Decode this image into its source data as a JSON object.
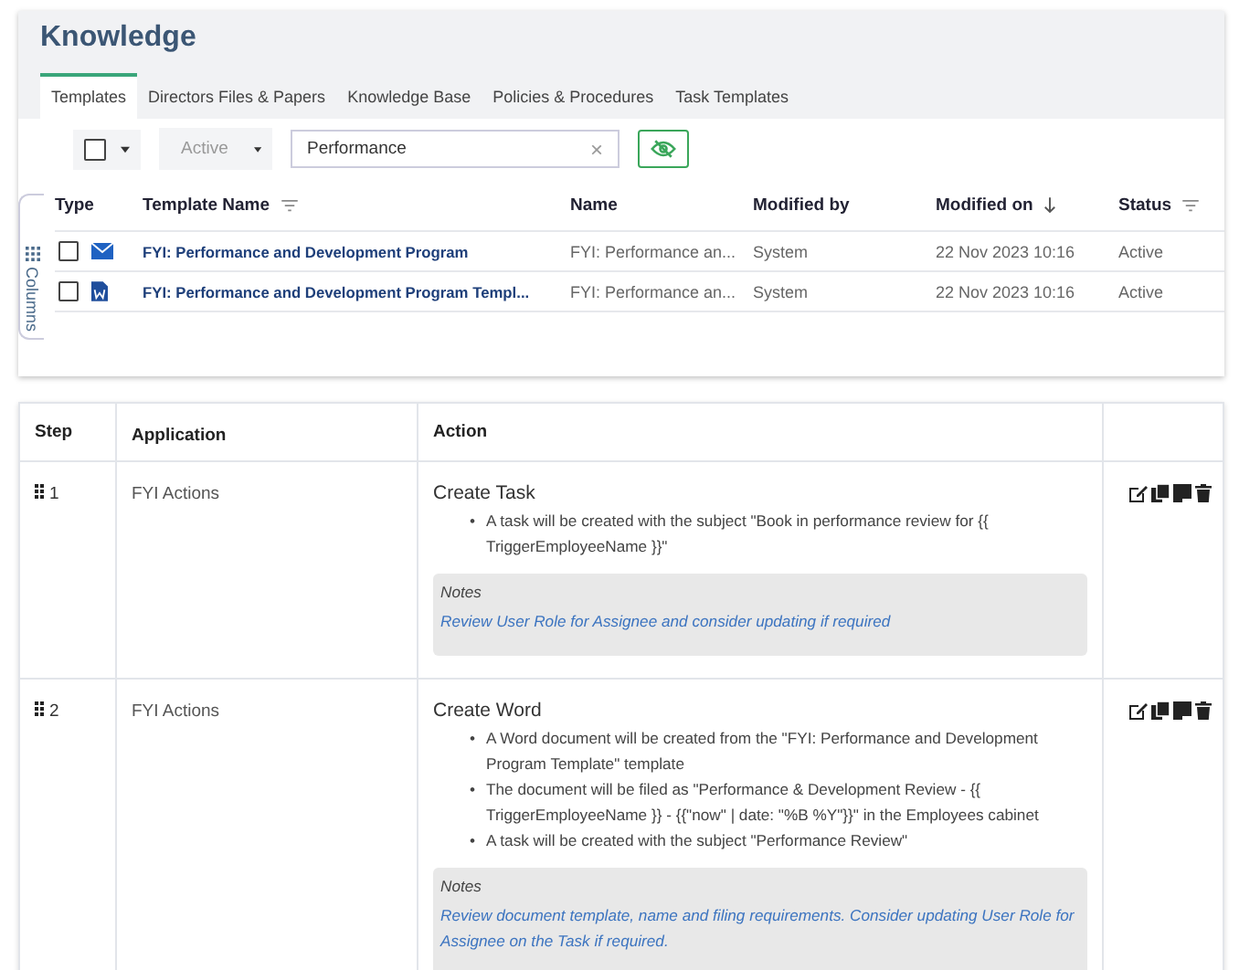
{
  "title": "Knowledge",
  "tabs": [
    {
      "label": "Templates",
      "selected": true
    },
    {
      "label": "Directors Files & Papers",
      "selected": false
    },
    {
      "label": "Knowledge Base",
      "selected": false
    },
    {
      "label": "Policies & Procedures",
      "selected": false
    },
    {
      "label": "Task Templates",
      "selected": false
    }
  ],
  "toolbar": {
    "select_all": {
      "checked": false
    },
    "status_filter": "Active",
    "search": {
      "value": "Performance",
      "clear": "×"
    }
  },
  "columns_panel": "Columns",
  "templates_table": {
    "columns": [
      {
        "label": "Type",
        "kind": "plain"
      },
      {
        "label": "Template Name",
        "kind": "filterable"
      },
      {
        "label": "Name",
        "kind": "plain"
      },
      {
        "label": "Modified by",
        "kind": "plain"
      },
      {
        "label": "Modified on",
        "kind": "sorted"
      },
      {
        "label": "Status",
        "kind": "filterable"
      }
    ],
    "rows": [
      {
        "checked": false,
        "kind": "email",
        "template_name": "FYI: Performance and Development Program",
        "name": "FYI: Performance an...",
        "modified_by": "System",
        "modified_on": "22 Nov 2023 10:16",
        "status": "Active"
      },
      {
        "checked": false,
        "kind": "word",
        "template_name": "FYI: Performance and Development Program Templ...",
        "name": "FYI: Performance an...",
        "modified_by": "System",
        "modified_on": "22 Nov 2023 10:16",
        "status": "Active"
      }
    ]
  },
  "steps_table": {
    "columns": [
      "Step",
      "Application",
      "Action"
    ],
    "rows": [
      {
        "step": "1",
        "application": "FYI Actions",
        "action": "Create Task",
        "bullets": [
          {
            "marker": "•",
            "text": "A task will be created with the subject \"Book in performance review for {{ TriggerEmployeeName }}\""
          }
        ],
        "notes_label": "Notes",
        "notes": "Review User Role for Assignee and consider updating if required"
      },
      {
        "step": "2",
        "application": "FYI Actions",
        "action": "Create Word",
        "bullets": [
          {
            "marker": "•",
            "text": "A Word document will be created from the \"FYI: Performance and Development Program Template\" template"
          },
          {
            "marker": "•",
            "text": "The document will be filed as \"Performance & Development Review - {{ TriggerEmployeeName }} - {{\"now\" | date: \"%B %Y\"}}\" in the Employees cabinet"
          },
          {
            "marker": "•",
            "text": "A task will be created with the subject \"Performance Review\""
          }
        ],
        "notes_label": "Notes",
        "notes": "Review document template, name and filing requirements. Consider updating User Role for Assignee on the Task if required."
      }
    ]
  }
}
